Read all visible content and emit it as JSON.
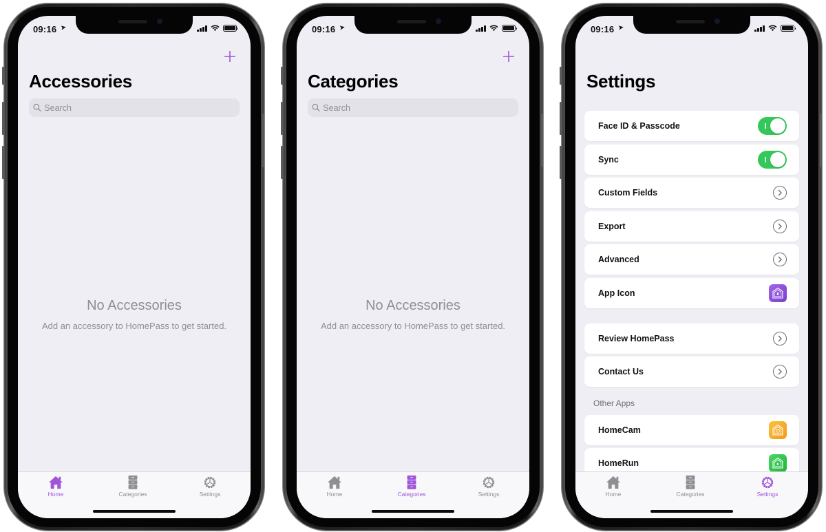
{
  "status_bar": {
    "time": "09:16",
    "location_icon": "location-arrow-icon",
    "signal_icon": "cellular-signal-icon",
    "wifi_icon": "wifi-icon",
    "battery_icon": "battery-icon"
  },
  "tab_bar": {
    "tabs": [
      {
        "label": "Home",
        "icon": "house-icon"
      },
      {
        "label": "Categories",
        "icon": "cabinet-icon"
      },
      {
        "label": "Settings",
        "icon": "gear-icon"
      }
    ]
  },
  "accent_color": "#a055d8",
  "screens": [
    {
      "title": "Accessories",
      "add_icon": "plus-icon",
      "search": {
        "placeholder": "Search",
        "value": ""
      },
      "empty_state": {
        "title": "No Accessories",
        "subtitle": "Add an accessory to HomePass to get started."
      },
      "active_tab": "Home"
    },
    {
      "title": "Categories",
      "add_icon": "plus-icon",
      "search": {
        "placeholder": "Search",
        "value": ""
      },
      "empty_state": {
        "title": "No Accessories",
        "subtitle": "Add an accessory to HomePass to get started."
      },
      "active_tab": "Categories"
    },
    {
      "title": "Settings",
      "active_tab": "Settings",
      "groups": [
        {
          "items": [
            {
              "label": "Face ID & Passcode",
              "accessory": "toggle",
              "on": true
            },
            {
              "label": "Sync",
              "accessory": "toggle",
              "on": true
            },
            {
              "label": "Custom Fields",
              "accessory": "chevron"
            },
            {
              "label": "Export",
              "accessory": "chevron"
            },
            {
              "label": "Advanced",
              "accessory": "chevron"
            },
            {
              "label": "App Icon",
              "accessory": "app-icon",
              "icon_color": "#8e4fd8"
            }
          ]
        },
        {
          "items": [
            {
              "label": "Review HomePass",
              "accessory": "chevron"
            },
            {
              "label": "Contact Us",
              "accessory": "chevron"
            }
          ]
        },
        {
          "header": "Other Apps",
          "items": [
            {
              "label": "HomeCam",
              "accessory": "app-icon",
              "icon_color": "#f5a623"
            },
            {
              "label": "HomeRun",
              "accessory": "app-icon",
              "icon_color": "#2fc94e"
            }
          ]
        }
      ]
    }
  ]
}
